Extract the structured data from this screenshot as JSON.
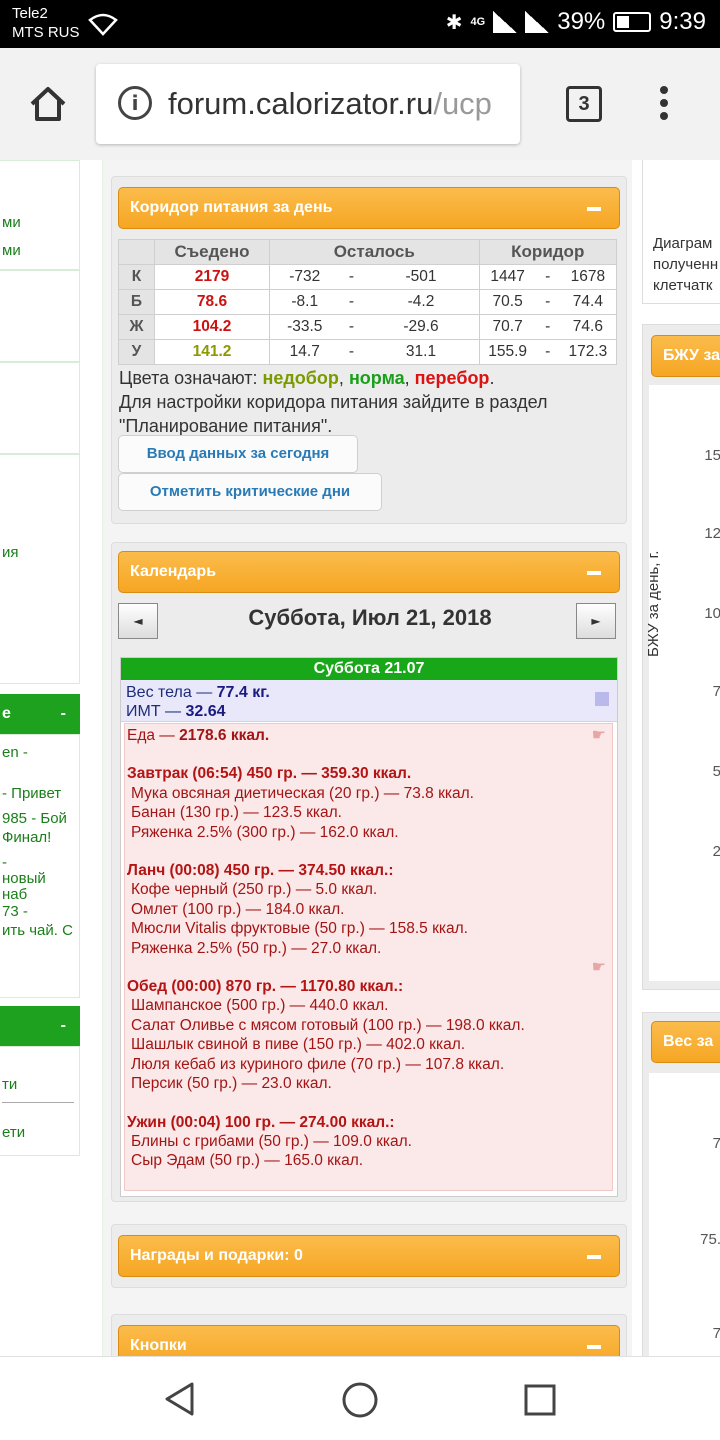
{
  "status": {
    "carrier1": "Tele2",
    "carrier2": "MTS RUS",
    "net": "4G",
    "battery": "39%",
    "time": "9:39"
  },
  "browser": {
    "url_main": "forum.calorizator.ru",
    "url_rest": "/ucp",
    "tabs_count": "3"
  },
  "left": {
    "b1": [
      "ми",
      "ми"
    ],
    "b2": [
      "ия"
    ],
    "head1": "е",
    "head1_dash": "-",
    "posts": [
      "en -",
      "- Привет",
      "985 - Бой",
      "Финал!",
      "-",
      "новый",
      "наб",
      "73 -",
      "ить чай. С"
    ],
    "head2": "",
    "head2_dash": "-",
    "links": [
      "ти",
      "ети"
    ]
  },
  "corridor": {
    "title": "Коридор питания за день",
    "headers": [
      "Съедено",
      "Осталось",
      "Коридор"
    ],
    "rows": [
      {
        "l": "К",
        "eaten": "2179",
        "r1": "-732",
        "r2": "-501",
        "c1": "1447",
        "c2": "1678"
      },
      {
        "l": "Б",
        "eaten": "78.6",
        "r1": "-8.1",
        "r2": "-4.2",
        "c1": "70.5",
        "c2": "74.4"
      },
      {
        "l": "Ж",
        "eaten": "104.2",
        "r1": "-33.5",
        "r2": "-29.6",
        "c1": "70.7",
        "c2": "74.6"
      },
      {
        "l": "У",
        "eaten": "141.2",
        "r1": "14.7",
        "r2": "31.1",
        "c1": "155.9",
        "c2": "172.3"
      }
    ],
    "dash": "-",
    "legend_prefix": "Цвета означают: ",
    "legend_under": "недобор",
    "legend_norm": "норма",
    "legend_over": "перебор",
    "sep": ", ",
    "dot": ".",
    "hint": "Для настройки коридора питания зайдите в раздел \"Планирование питания\".",
    "btn_enter": "Ввод данных за сегодня",
    "btn_critical": "Отметить критические дни",
    "accent": "#f6a623"
  },
  "calendar": {
    "title": "Календарь",
    "prev": "◄",
    "next": "►",
    "date": "Суббота, Июл 21, 2018",
    "day_head": "Суббота 21.07",
    "weight_label": "Вес тела — ",
    "weight_value": "77.4 кг.",
    "bmi_label": "ИМТ — ",
    "bmi_value": "32.64",
    "food_label": "Еда — ",
    "food_value": "2178.6 ккал.",
    "meals": [
      {
        "head": "Завтрак (06:54) 450 гр. — 359.30 ккал.",
        "items": [
          "Мука овсяная диетическая (20 гр.) — 73.8 ккал.",
          "Банан (130 гр.) — 123.5 ккал.",
          "Ряженка 2.5% (300 гр.) — 162.0 ккал."
        ]
      },
      {
        "head": "Ланч (00:08) 450 гр. — 374.50 ккал.:",
        "items": [
          "Кофе черный (250 гр.) — 5.0 ккал.",
          "Омлет (100 гр.) — 184.0 ккал.",
          "Мюсли Vitalis фруктовые (50 гр.) — 158.5 ккал.",
          "Ряженка 2.5% (50 гр.) — 27.0 ккал."
        ]
      },
      {
        "head": "Обед (00:00) 870 гр. — 1170.80 ккал.:",
        "items": [
          "Шампанское (500 гр.) — 440.0 ккал.",
          "Салат Оливье с мясом готовый (100 гр.) — 198.0 ккал.",
          "Шашлык свиной в пиве (150 гр.) — 402.0 ккал.",
          "Люля кебаб из куриного филе (70 гр.) — 107.8 ккал.",
          "Персик (50 гр.) — 23.0 ккал."
        ]
      },
      {
        "head": "Ужин (00:04) 100 гр. — 274.00 ккал.:",
        "items": [
          "Блины с грибами (50 гр.) — 109.0 ккал.",
          "Сыр Эдам (50 гр.) — 165.0 ккал."
        ]
      }
    ]
  },
  "rewards": {
    "title": "Награды и подарки: 0"
  },
  "buttons_panel": {
    "title": "Кнопки"
  },
  "right": {
    "text": [
      "Диаграм",
      "полученн",
      "клетчатк"
    ],
    "bju_title": "БЖУ за",
    "bju_ticks": [
      "15",
      "12",
      "10",
      "7",
      "5",
      "2"
    ],
    "ylabel": "БЖУ за день, г.",
    "weight_title": "Вес за",
    "weight_ticks": [
      "7",
      "75.",
      "7"
    ]
  }
}
